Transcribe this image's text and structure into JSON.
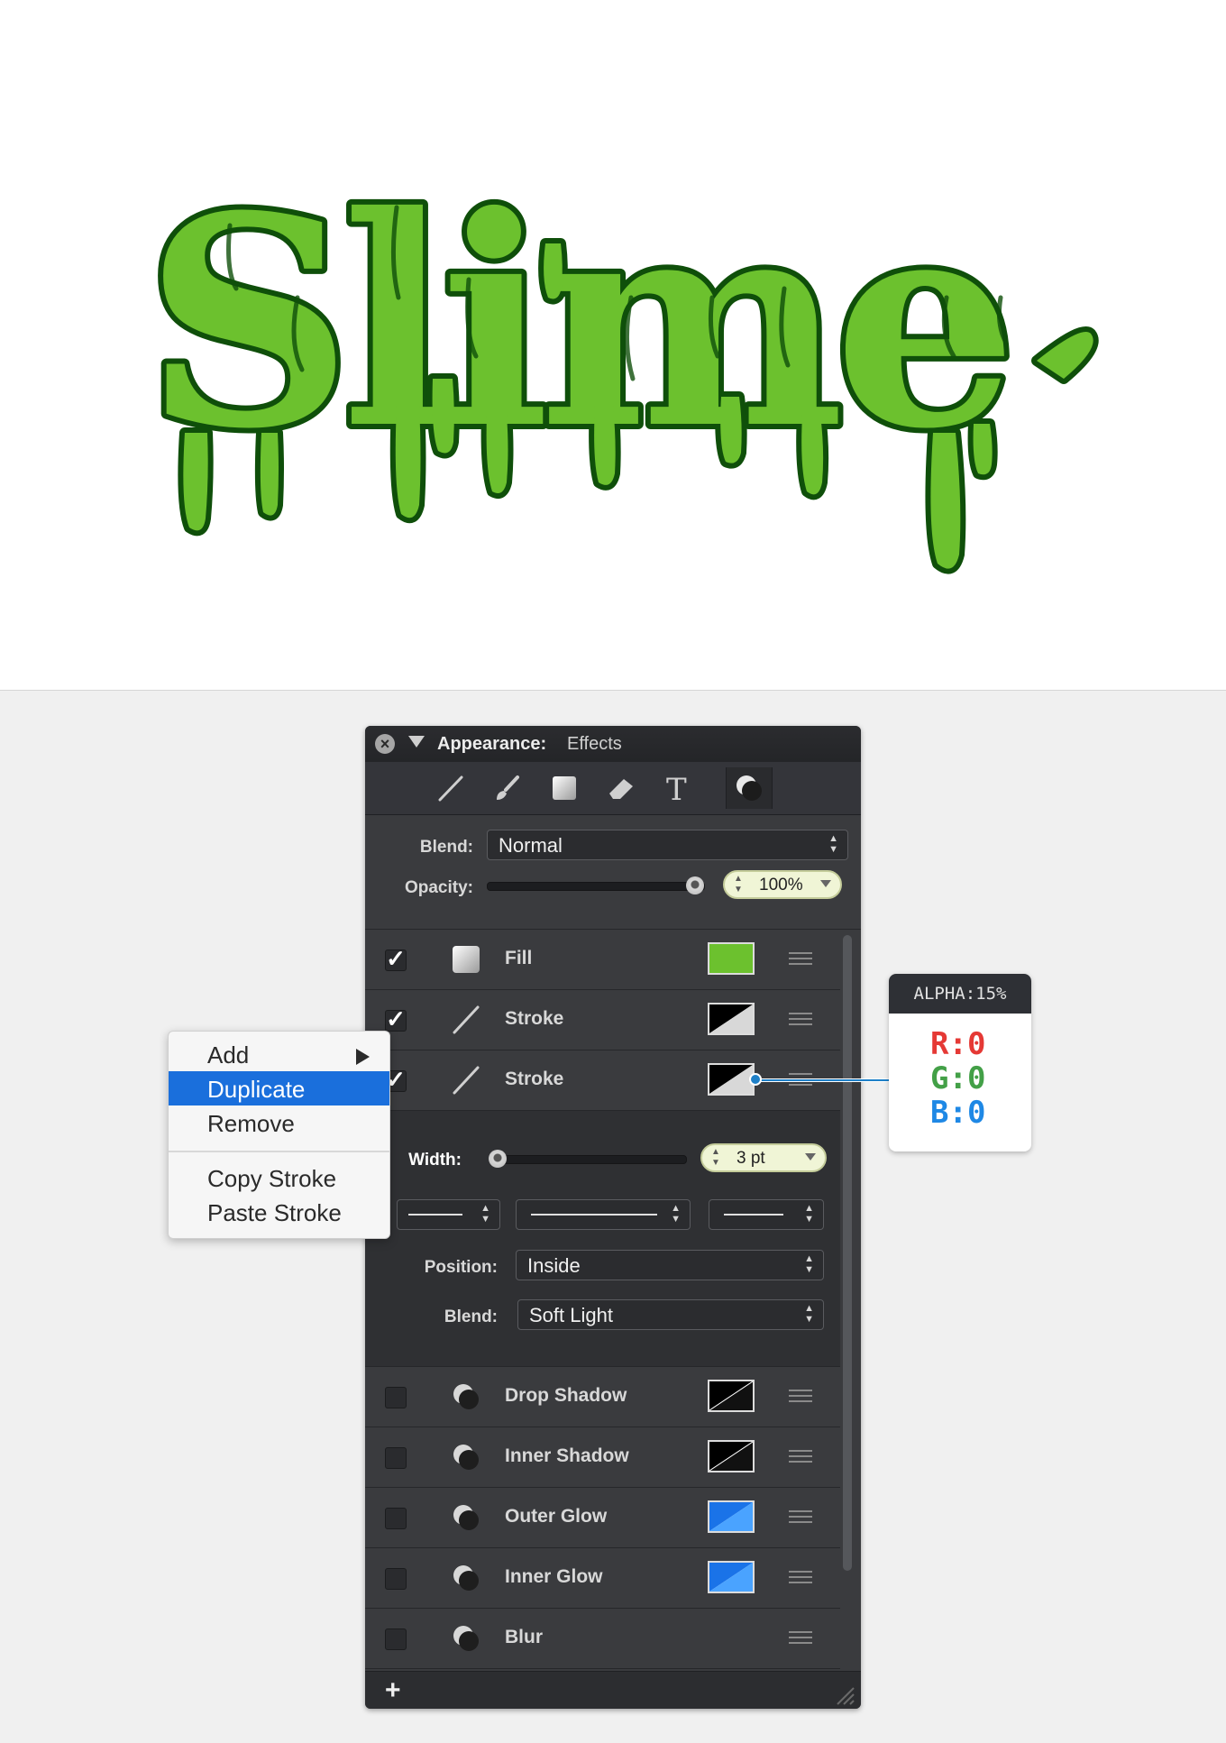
{
  "artwork": {
    "text": "Slime",
    "colors": {
      "fill": "#6cc12e",
      "outline": "#0f4f0a",
      "highlight": "#8fd45a"
    }
  },
  "panel": {
    "title": "Appearance:",
    "subtitle": "Effects",
    "tools": [
      "line-tool-icon",
      "brush-tool-icon",
      "square-tool-icon",
      "eraser-tool-icon",
      "text-tool-icon",
      "effects-tool-icon"
    ],
    "blend_label": "Blend:",
    "blend_value": "Normal",
    "opacity_label": "Opacity:",
    "opacity_value": "100%",
    "opacity_level": 1.0,
    "rows": [
      {
        "checked": true,
        "name": "Fill",
        "icon": "fill-square-icon",
        "swatch": "#6cc12e"
      },
      {
        "checked": true,
        "name": "Stroke",
        "icon": "stroke-line-icon",
        "swatch": "black-white-diagonal"
      },
      {
        "checked": true,
        "name": "Stroke",
        "icon": "stroke-line-icon",
        "swatch": "black-white-diagonal"
      }
    ],
    "stroke_detail": {
      "width_label": "Width:",
      "width_value": "3 pt",
      "position_label": "Position:",
      "position_value": "Inside",
      "blend_label": "Blend:",
      "blend_value": "Soft Light"
    },
    "effects": [
      {
        "checked": false,
        "name": "Drop Shadow",
        "swatch": "black-white-diagonal"
      },
      {
        "checked": false,
        "name": "Inner Shadow",
        "swatch": "black-white-diagonal"
      },
      {
        "checked": false,
        "name": "Outer Glow",
        "swatch": "blue-diagonal"
      },
      {
        "checked": false,
        "name": "Inner Glow",
        "swatch": "blue-diagonal"
      },
      {
        "checked": false,
        "name": "Blur",
        "swatch": ""
      }
    ],
    "add_label": "+"
  },
  "context_menu": {
    "items": [
      "Add",
      "Duplicate",
      "Remove",
      "Copy Stroke",
      "Paste Stroke"
    ],
    "selected": "Duplicate"
  },
  "callout": {
    "header": "ALPHA:15%",
    "r": "R:0",
    "g": "G:0",
    "b": "B:0",
    "colors": {
      "r": "#e53935",
      "g": "#43a047",
      "b": "#1e88e5"
    }
  }
}
